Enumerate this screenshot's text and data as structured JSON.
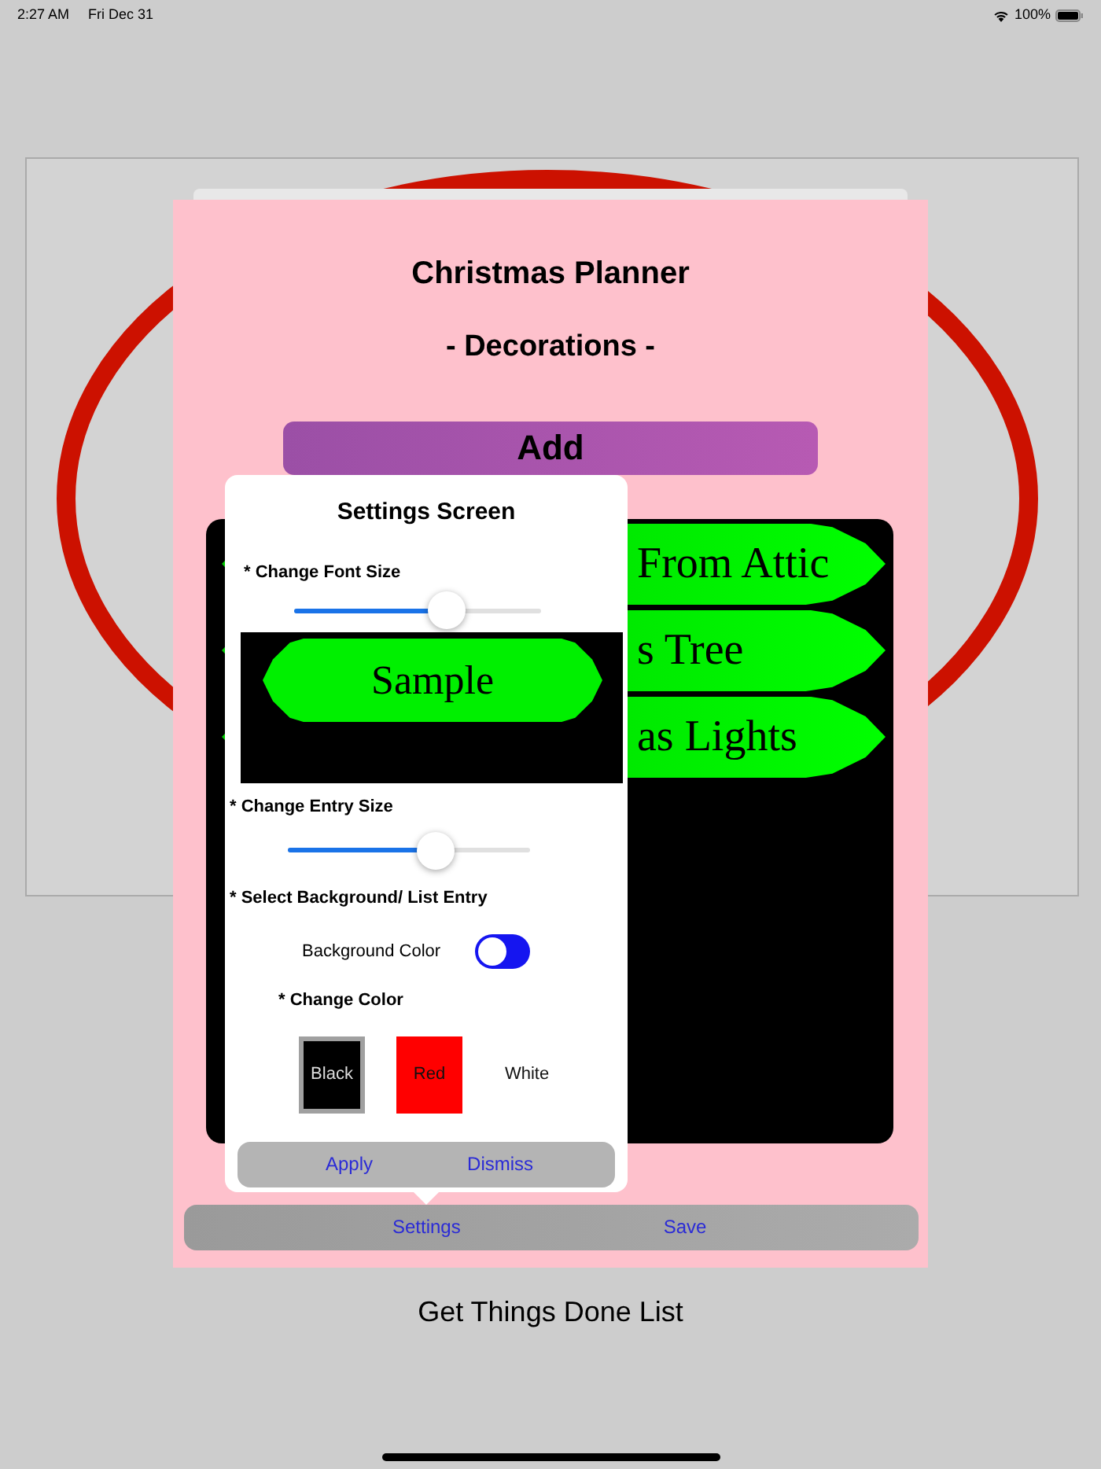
{
  "status_bar": {
    "time": "2:27 AM",
    "date": "Fri Dec 31",
    "battery": "100%"
  },
  "planner": {
    "title": "Christmas Planner",
    "subtitle": "- Decorations -",
    "add_button": "Add",
    "items": [
      {
        "text": "From Attic"
      },
      {
        "text": "s Tree"
      },
      {
        "text": "as Lights"
      }
    ],
    "toolbar": [
      "Settings",
      "Save"
    ]
  },
  "settings": {
    "title": "Settings Screen",
    "font_size_label": "* Change Font Size",
    "font_size": {
      "level": 0.62
    },
    "sample": "Sample",
    "entry_size_label": "* Change Entry Size",
    "entry_size": {
      "level": 0.61
    },
    "background_label": "* Select Background/ List Entry",
    "background_toggle": {
      "label": "Background Color",
      "on": false
    },
    "color_label": "* Change Color",
    "colors": [
      {
        "label": "Black",
        "selected": true,
        "color": "#000000"
      },
      {
        "label": "Red",
        "selected": false,
        "color": "#ff0000"
      },
      {
        "label": "White",
        "selected": false,
        "color": "#ffffff"
      }
    ],
    "buttons": [
      "Apply",
      "Dismiss"
    ]
  },
  "footer": "Get Things Done List"
}
